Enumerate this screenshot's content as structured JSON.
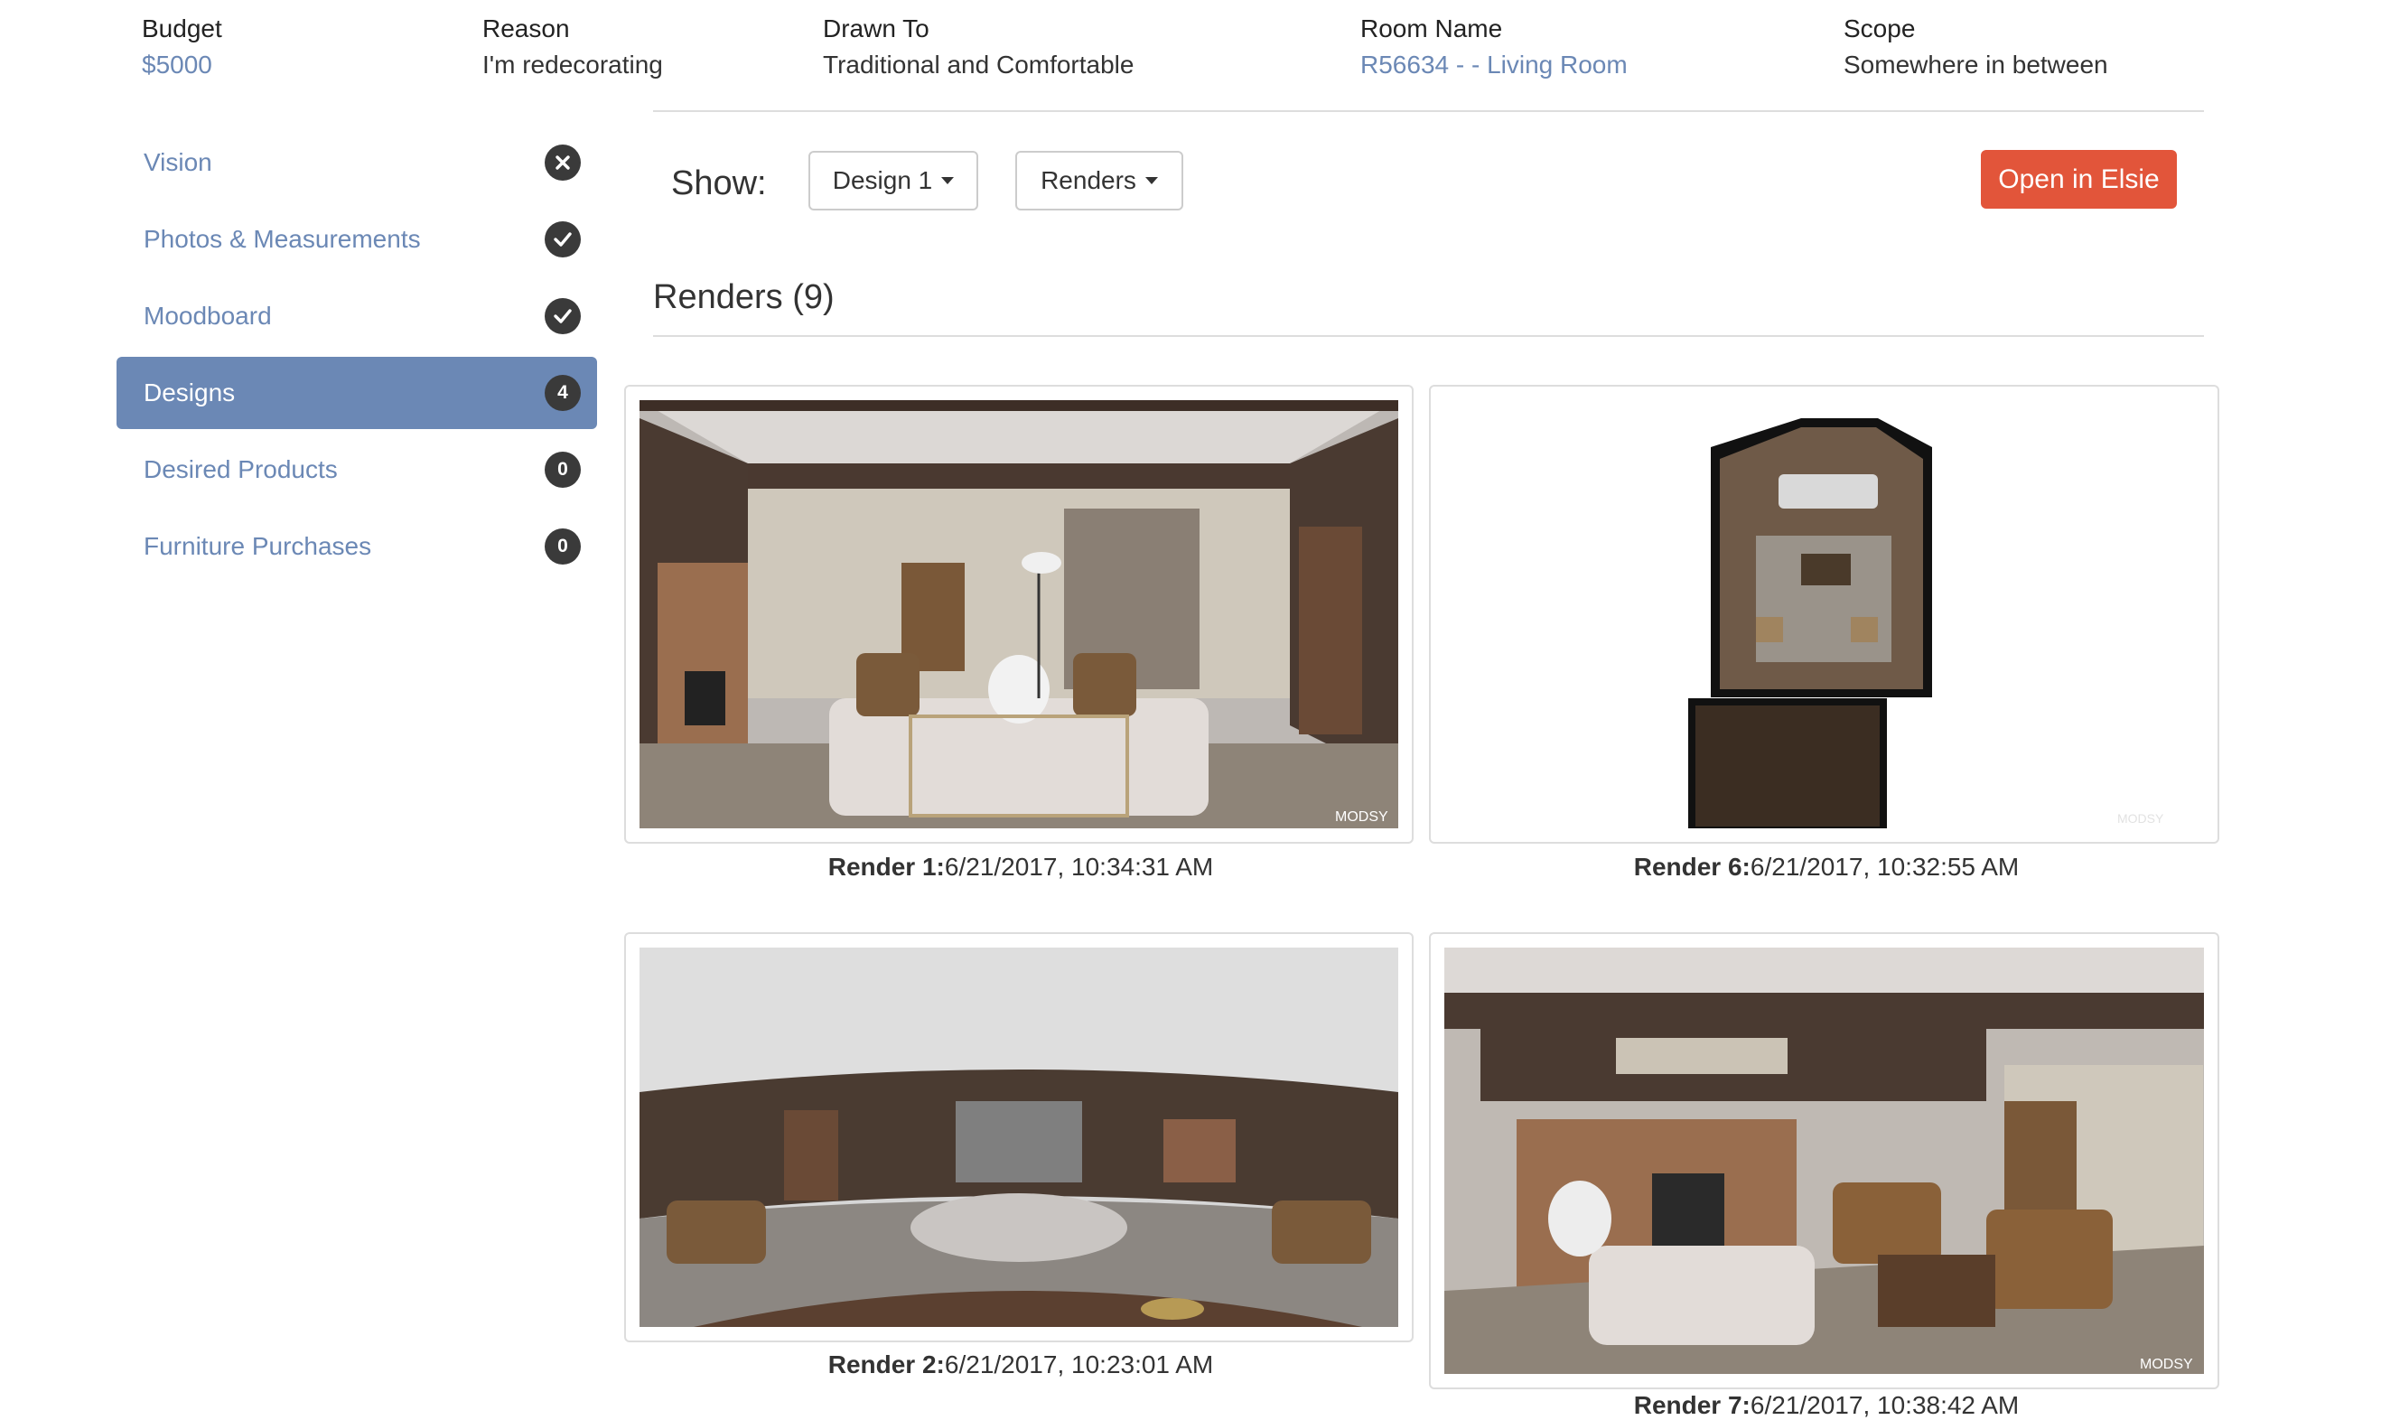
{
  "header": {
    "budget": {
      "label": "Budget",
      "value": "$5000"
    },
    "reason": {
      "label": "Reason",
      "value": "I'm redecorating"
    },
    "drawn_to": {
      "label": "Drawn To",
      "value": "Traditional and Comfortable"
    },
    "room_name": {
      "label": "Room Name",
      "value": "R56634 - - Living Room"
    },
    "scope": {
      "label": "Scope",
      "value": "Somewhere in between"
    }
  },
  "sidebar": {
    "items": [
      {
        "label": "Vision",
        "status": "x-icon"
      },
      {
        "label": "Photos & Measurements",
        "status": "check-icon"
      },
      {
        "label": "Moodboard",
        "status": "check-icon"
      },
      {
        "label": "Designs",
        "count": "4",
        "active": true
      },
      {
        "label": "Desired Products",
        "count": "0"
      },
      {
        "label": "Furniture Purchases",
        "count": "0"
      }
    ]
  },
  "toolbar": {
    "show_label": "Show:",
    "design_select": "Design 1",
    "view_select": "Renders",
    "open_button": "Open in Elsie"
  },
  "section": {
    "title": "Renders (9)"
  },
  "renders": [
    {
      "name": "Render 1:",
      "timestamp": "6/21/2017, 10:34:31 AM",
      "watermark": "MODSY"
    },
    {
      "name": "Render 6:",
      "timestamp": "6/21/2017, 10:32:55 AM",
      "watermark": "MODSY"
    },
    {
      "name": "Render 2:",
      "timestamp": "6/21/2017, 10:23:01 AM"
    },
    {
      "name": "Render 7:",
      "timestamp": "6/21/2017, 10:38:42 AM",
      "watermark": "MODSY"
    }
  ],
  "colors": {
    "accent": "#6b88b5",
    "primary": "#e2553a",
    "badge": "#3a3a3a"
  }
}
